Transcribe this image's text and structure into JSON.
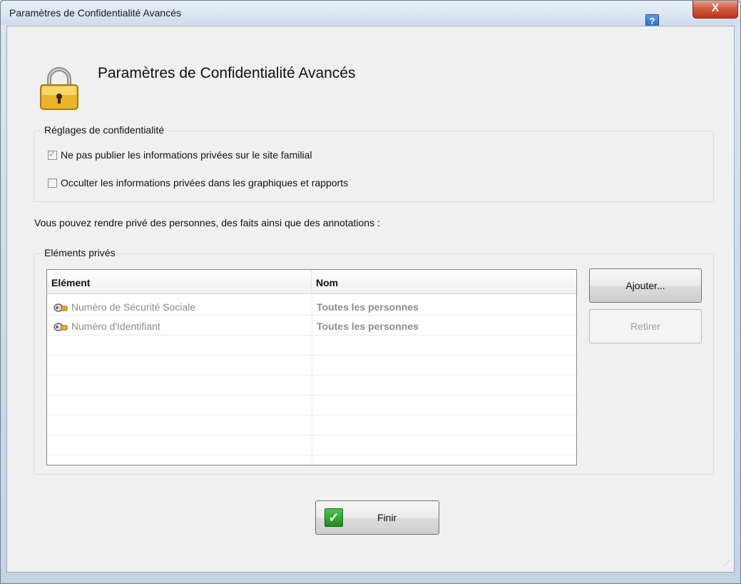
{
  "window": {
    "title": "Paramètres de Confidentialité Avancés",
    "help_label": "?",
    "close_label": "X"
  },
  "heading": "Paramètres de Confidentialité Avancés",
  "privacy_settings": {
    "legend": "Réglages de confidentialité",
    "options": [
      {
        "label": "Ne pas publier les informations privées sur le site familial",
        "checked": true,
        "disabled": true
      },
      {
        "label": "Occulter les informations privées dans les graphiques et rapports",
        "checked": false,
        "disabled": false
      }
    ]
  },
  "info_text": "Vous pouvez rendre privé des personnes, des faits ainsi que des annotations :",
  "private_items": {
    "legend": "Eléments privés",
    "columns": [
      "Elément",
      "Nom"
    ],
    "rows": [
      {
        "element": "Numéro de Sécurité Sociale",
        "name": "Toutes les personnes",
        "icon": "key-icon"
      },
      {
        "element": "Numéro d'Identifiant",
        "name": "Toutes les personnes",
        "icon": "key-icon"
      }
    ],
    "add_label": "Ajouter...",
    "remove_label": "Retirer"
  },
  "finish_label": "Finir",
  "colors": {
    "accent": "#2466c9",
    "close": "#c8442a",
    "finish_check": "#2ea62e",
    "disabled_text": "#8c8c8c"
  }
}
